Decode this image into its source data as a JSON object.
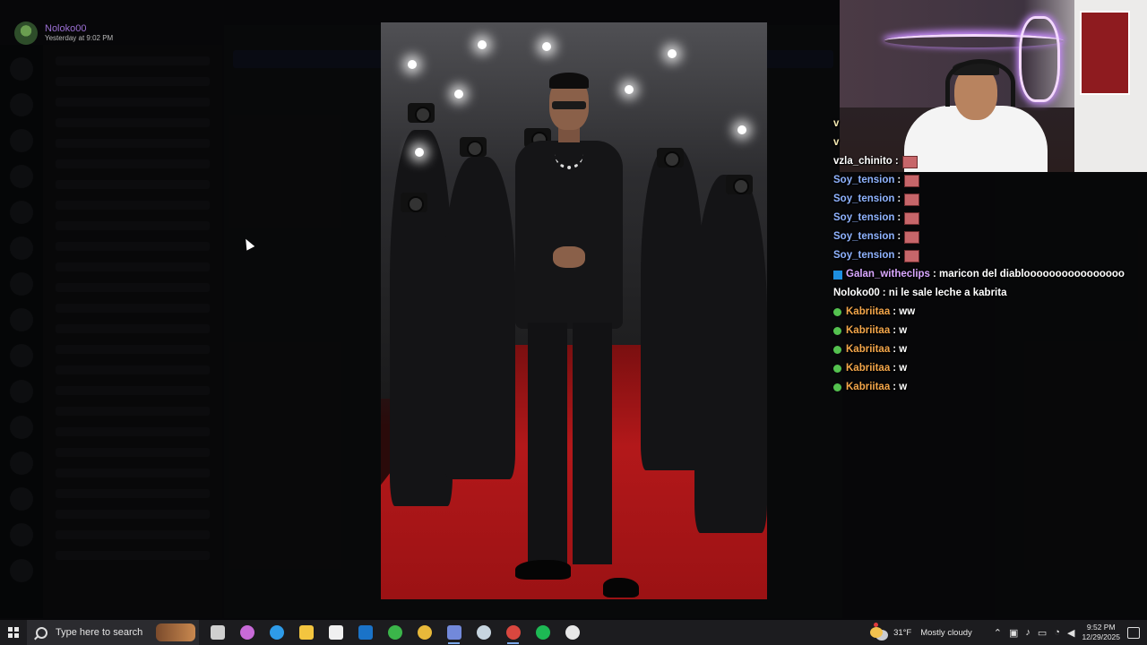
{
  "discord_post": {
    "username": "Noloko00",
    "timestamp": "Yesterday at 9:02 PM"
  },
  "chat": {
    "messages": [
      {
        "user": "v",
        "text": "",
        "color": "#f1e6b0",
        "badge": "",
        "emote": false
      },
      {
        "user": "v",
        "text": "",
        "color": "#f1e6b0",
        "badge": "",
        "emote": false
      },
      {
        "user": "vzla_chinito",
        "text": ":",
        "color": "#ffffff",
        "badge": "",
        "emote": true
      },
      {
        "user": "Soy_tension",
        "text": ":",
        "color": "#8fb3ff",
        "badge": "",
        "emote": true
      },
      {
        "user": "Soy_tension",
        "text": ":",
        "color": "#8fb3ff",
        "badge": "",
        "emote": true
      },
      {
        "user": "Soy_tension",
        "text": ":",
        "color": "#8fb3ff",
        "badge": "",
        "emote": true
      },
      {
        "user": "Soy_tension",
        "text": ":",
        "color": "#8fb3ff",
        "badge": "",
        "emote": true
      },
      {
        "user": "Soy_tension",
        "text": ":",
        "color": "#8fb3ff",
        "badge": "",
        "emote": true
      },
      {
        "user": "Galan_witheclips",
        "text": ": maricon del diabloooooooooooooooo",
        "color": "#d9a7ff",
        "badge": "clip",
        "emote": false
      },
      {
        "user": "Noloko00",
        "text": ": ni le sale leche a kabrita",
        "color": "#ffffff",
        "badge": "",
        "emote": false
      },
      {
        "user": "Kabriitaa",
        "text": ": ww",
        "color": "#f4a64a",
        "badge": "dot",
        "emote": false
      },
      {
        "user": "Kabriitaa",
        "text": ": w",
        "color": "#f4a64a",
        "badge": "dot",
        "emote": false
      },
      {
        "user": "Kabriitaa",
        "text": ": w",
        "color": "#f4a64a",
        "badge": "dot",
        "emote": false
      },
      {
        "user": "Kabriitaa",
        "text": ": w",
        "color": "#f4a64a",
        "badge": "dot",
        "emote": false
      },
      {
        "user": "Kabriitaa",
        "text": ": w",
        "color": "#f4a64a",
        "badge": "dot",
        "emote": false
      }
    ]
  },
  "taskbar": {
    "search_placeholder": "Type here to search",
    "apps": [
      {
        "name": "task-view",
        "color": "#cfcfcf",
        "active": false
      },
      {
        "name": "copilot",
        "color": "#c86ad8",
        "active": false
      },
      {
        "name": "edge",
        "color": "#2e9be8",
        "active": false
      },
      {
        "name": "file-explorer",
        "color": "#f3c53f",
        "active": false
      },
      {
        "name": "microsoft-store",
        "color": "#f0f0f0",
        "active": false
      },
      {
        "name": "outlook",
        "color": "#1a73c8",
        "active": false
      },
      {
        "name": "xbox",
        "color": "#3bb54a",
        "active": false
      },
      {
        "name": "chrome",
        "color": "#e8b93a",
        "active": false
      },
      {
        "name": "discord",
        "color": "#7289da",
        "active": true
      },
      {
        "name": "steam",
        "color": "#c7d5e0",
        "active": false
      },
      {
        "name": "chrome-profile",
        "color": "#d9473f",
        "active": true
      },
      {
        "name": "spotify",
        "color": "#1db954",
        "active": false
      },
      {
        "name": "obs",
        "color": "#e8e8e8",
        "active": false
      }
    ],
    "weather": {
      "temp": "31°F",
      "condition": "Mostly cloudy"
    },
    "clock": {
      "time": "9:52 PM",
      "date": "12/29/2025"
    }
  }
}
